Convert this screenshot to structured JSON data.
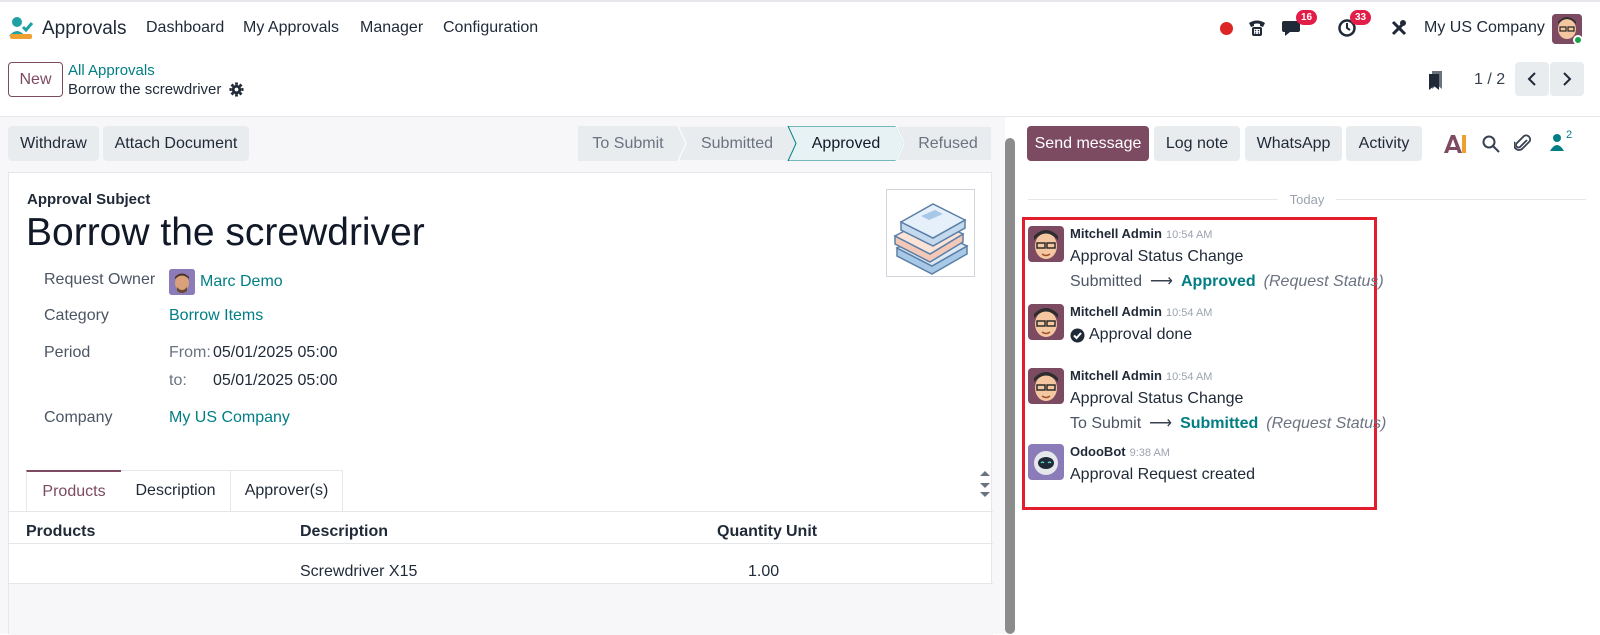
{
  "navbar": {
    "app_name": "Approvals",
    "menus": [
      "Dashboard",
      "My Approvals",
      "Manager",
      "Configuration"
    ],
    "messages_badge": "16",
    "activities_badge": "33",
    "company": "My US Company"
  },
  "control_panel": {
    "new_label": "New",
    "breadcrumb_parent": "All Approvals",
    "breadcrumb_current": "Borrow the screwdriver",
    "pager": "1 / 2"
  },
  "statusbar": {
    "withdraw_label": "Withdraw",
    "attach_label": "Attach Document",
    "stages": [
      "To Submit",
      "Submitted",
      "Approved",
      "Refused"
    ],
    "active_stage": "Approved"
  },
  "form": {
    "subject_label": "Approval Subject",
    "title": "Borrow the screwdriver",
    "fields": {
      "owner_label": "Request Owner",
      "owner_value": "Marc Demo",
      "category_label": "Category",
      "category_value": "Borrow Items",
      "period_label": "Period",
      "from_label": "From:",
      "from_value": "05/01/2025 05:00",
      "to_label": "to:",
      "to_value": "05/01/2025 05:00",
      "company_label": "Company",
      "company_value": "My US Company"
    },
    "tabs": [
      "Products",
      "Description",
      "Approver(s)"
    ],
    "table": {
      "columns": [
        "Products",
        "Description",
        "Quantity",
        "Unit"
      ],
      "rows": [
        {
          "product": "",
          "description": "Screwdriver X15",
          "quantity": "1.00",
          "unit": ""
        }
      ]
    }
  },
  "chatter": {
    "send_message_label": "Send message",
    "log_note_label": "Log note",
    "whatsapp_label": "WhatsApp",
    "activity_label": "Activity",
    "followers_count": "2",
    "date_separator": "Today",
    "messages": [
      {
        "author": "Mitchell Admin",
        "time": "10:54 AM",
        "body": "Approval Status Change",
        "tracking_old": "Submitted",
        "tracking_new": "Approved",
        "tracking_field": "(Request Status)"
      },
      {
        "author": "Mitchell Admin",
        "time": "10:54 AM",
        "body": "Approval done"
      },
      {
        "author": "Mitchell Admin",
        "time": "10:54 AM",
        "body": "Approval Status Change",
        "tracking_old": "To Submit",
        "tracking_new": "Submitted",
        "tracking_field": "(Request Status)"
      },
      {
        "author": "OdooBot",
        "time": "9:38 AM",
        "body": "Approval Request created"
      }
    ]
  },
  "colors": {
    "brand": "#7c4a61",
    "link": "#017e84",
    "highlight": "#e11d2e",
    "badge": "#e11d48"
  }
}
